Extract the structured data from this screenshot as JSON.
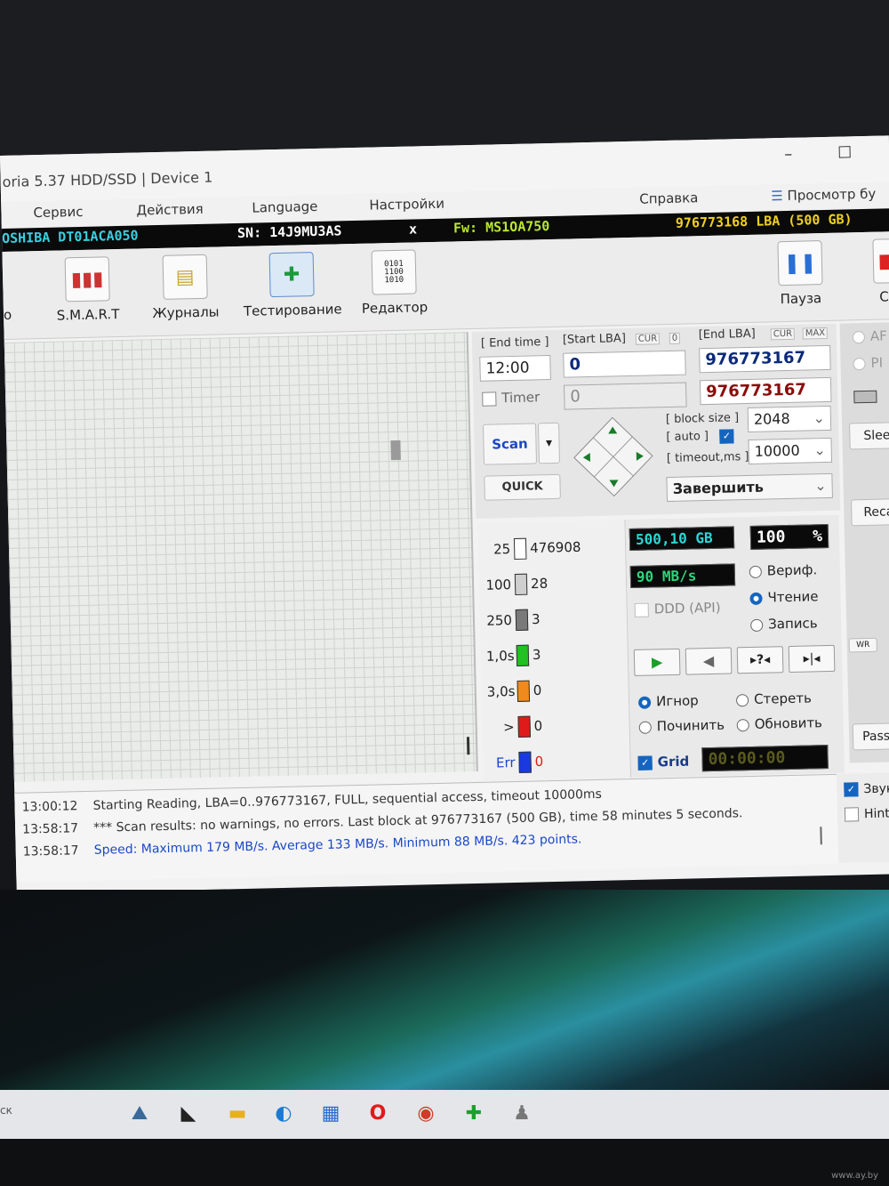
{
  "window": {
    "title": "oria 5.37 HDD/SSD | Device 1",
    "minimize": "–",
    "maximize": "☐"
  },
  "menu": [
    "Сервис",
    "Действия",
    "Language",
    "Настройки",
    "Справка",
    "Просмотр бу"
  ],
  "info": {
    "model": "OSHIBA DT01ACA050",
    "serial": "SN: 14J9MU3AS",
    "close": "x",
    "firmware": "Fw: MS1OA750",
    "capacity": "976773168 LBA (500 GB)"
  },
  "toolbar": {
    "items": [
      "S.M.A.R.T",
      "Журналы",
      "Тестирование",
      "Редактор"
    ],
    "pause": "Пауза",
    "stop": "Ст",
    "left_cut": "о"
  },
  "scan": {
    "end_time_label": "[ End time ]",
    "end_time_value": "12:00",
    "timer_label": "Timer",
    "start_lba_label": "[Start LBA]",
    "start_lba_cur": "CUR",
    "start_lba_cur_value": "0",
    "start_lba_value": "0",
    "start_lba_value2": "0",
    "end_lba_label": "[End LBA]",
    "end_lba_cur": "CUR",
    "end_lba_max": "MAX",
    "end_lba_value": "976773167",
    "end_lba_value2": "976773167",
    "block_size_label": "[ block size ]",
    "auto_label": "[ auto ]",
    "block_size_value": "2048",
    "timeout_label": "[ timeout,ms ]",
    "timeout_value": "10000",
    "scan_button": "Scan",
    "quick_button": "QUICK",
    "finish_select": "Завершить"
  },
  "stats": [
    {
      "label": "25",
      "count": "476908",
      "color": "#ffffff"
    },
    {
      "label": "100",
      "count": "28",
      "color": "#cfcfcf"
    },
    {
      "label": "250",
      "count": "3",
      "color": "#7a7a7a"
    },
    {
      "label": "1,0s",
      "count": "3",
      "color": "#22c022"
    },
    {
      "label": "3,0s",
      "count": "0",
      "color": "#f08a1c"
    },
    {
      "label": ">",
      "count": "0",
      "color": "#e01a1a"
    },
    {
      "label": "Err",
      "count": "0",
      "color": "#1a3ae0"
    }
  ],
  "readouts": {
    "size": "500,10 GB",
    "percent": "100",
    "percent_sign": "%",
    "speed": "90 MB/s",
    "ddd_label": "DDD (API)",
    "mode_verify": "Вериф.",
    "mode_read": "Чтение",
    "mode_write": "Запись",
    "act_ignore": "Игнор",
    "act_erase": "Стереть",
    "act_repair": "Починить",
    "act_refresh": "Обновить",
    "grid_label": "Grid",
    "timer": "00:00:00"
  },
  "side": {
    "opt1": "AF",
    "opt2": "PI",
    "sleep": "Slee",
    "recal": "Reca",
    "wr": "WR",
    "passp": "Passp"
  },
  "log": [
    {
      "time": "13:00:12",
      "text": "Starting Reading, LBA=0..976773167, FULL, sequential access, timeout 10000ms",
      "color": "#333333"
    },
    {
      "time": "13:58:17",
      "text": "*** Scan results: no warnings, no errors. Last block at 976773167 (500 GB), time 58 minutes 5 seconds.",
      "color": "#333333"
    },
    {
      "time": "13:58:17",
      "text": "Speed: Maximum 179 MB/s. Average 133 MB/s. Minimum 88 MB/s. 423 points.",
      "color": "#1a47c8"
    }
  ],
  "log_side": {
    "sound": "Звук",
    "hints": "Hints"
  },
  "taskbar": {
    "left_text": "ск"
  },
  "watermark": "www.ay.by"
}
